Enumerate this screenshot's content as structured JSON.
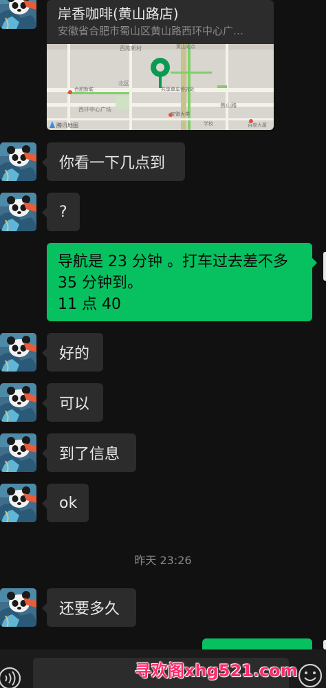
{
  "colors": {
    "background": "#111111",
    "bubble_other": "#2c2c2c",
    "bubble_self": "#07c160",
    "text_light": "#e8e8e8",
    "text_muted": "#8a8a8a",
    "watermark": "#ff2a6a"
  },
  "location_card": {
    "title": "岸香咖啡(黄山路店)",
    "address": "安徽省合肥市蜀山区黄山路西环中心广…",
    "map_labels": {
      "logo": "腾讯地图",
      "poi_1": "合肥新联",
      "poi_2": "安徽大学",
      "poi_3": "西环中心广场",
      "poi_4": "北区",
      "poi_4b": "黄山路",
      "poi_5": "共享单车停放处",
      "poi_6": "学校",
      "poi_7": "百度大厦",
      "poi_8": "西苑新村",
      "poi_9": "黄山站点"
    }
  },
  "messages": [
    {
      "sender": "other",
      "text": "你看一下几点到"
    },
    {
      "sender": "other",
      "text": "?"
    },
    {
      "sender": "self",
      "lines": [
        "导航是 23 分钟 。打车过去差不多",
        "35 分钟到。",
        "11 点 40"
      ]
    },
    {
      "sender": "other",
      "text": "好的"
    },
    {
      "sender": "other",
      "text": "可以"
    },
    {
      "sender": "other",
      "text": "到了信息"
    },
    {
      "sender": "other",
      "text": "ok"
    },
    {
      "sender": "other",
      "text": "还要多久"
    }
  ],
  "timestamp": "昨天 23:26",
  "input_bar": {
    "voice_icon": "voice-icon",
    "emoji_icon": "emoji-icon"
  },
  "watermark": "寻欢阁xhg521.com"
}
